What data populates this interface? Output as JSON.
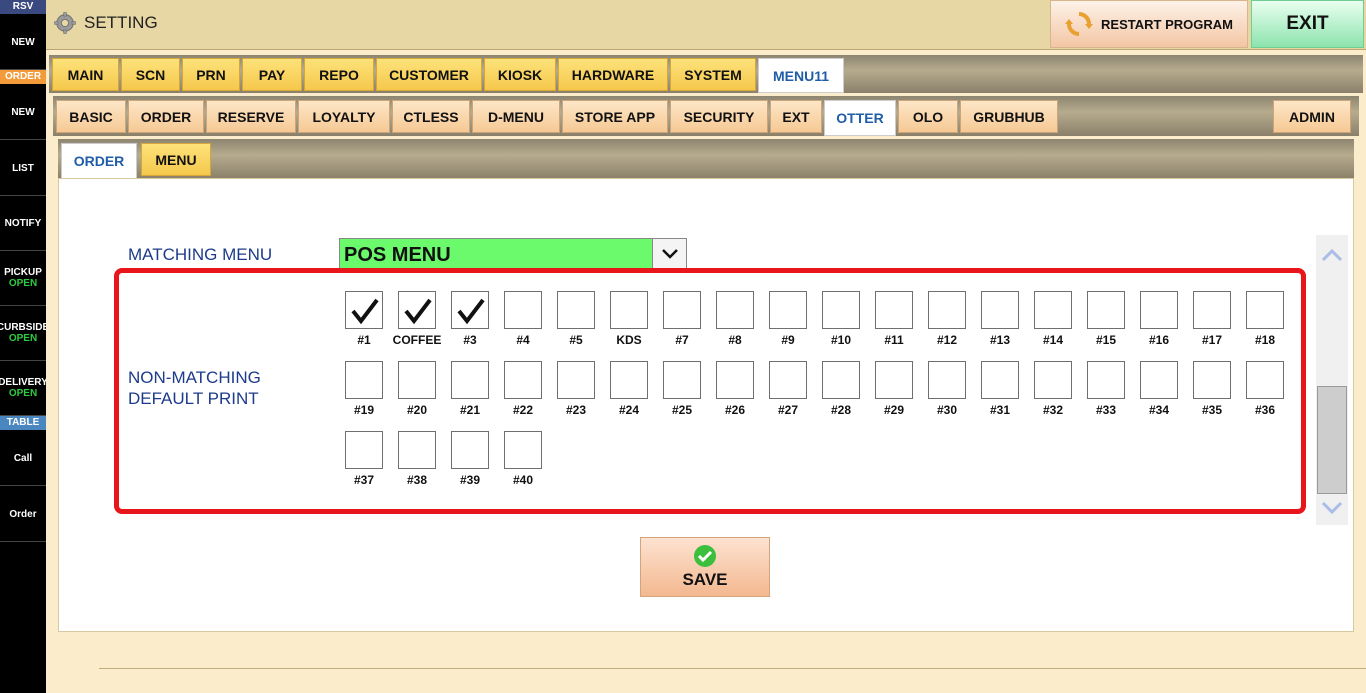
{
  "sidebar": {
    "headers": {
      "rsv": "RSV",
      "order": "ORDER",
      "table": "TABLE"
    },
    "header_colors": {
      "rsv": "#3a4a80",
      "order": "#f39a3a",
      "table": "#4a87c0"
    },
    "items": {
      "rsv_new": "NEW",
      "order_new": "NEW",
      "list": "LIST",
      "notify": "NOTIFY",
      "pickup": "PICKUP",
      "pickup_status": "OPEN",
      "curbside": "CURBSIDE",
      "curbside_status": "OPEN",
      "delivery": "DELIVERY",
      "delivery_status": "OPEN",
      "call": "Call",
      "order": "Order"
    }
  },
  "header": {
    "title": "SETTING",
    "restart_label": "RESTART PROGRAM",
    "exit_label": "EXIT"
  },
  "main_tabs": [
    "MAIN",
    "SCN",
    "PRN",
    "PAY",
    "REPO",
    "CUSTOMER",
    "KIOSK",
    "HARDWARE",
    "SYSTEM",
    "MENU11"
  ],
  "main_tab_active": "MENU11",
  "sub_tabs": [
    "BASIC",
    "ORDER",
    "RESERVE",
    "LOYALTY",
    "CTLESS",
    "D-MENU",
    "STORE APP",
    "SECURITY",
    "EXT",
    "OTTER",
    "OLO",
    "GRUBHUB"
  ],
  "sub_tab_active": "OTTER",
  "admin_tab": "ADMIN",
  "inner_tabs": [
    "ORDER",
    "MENU"
  ],
  "inner_tab_active": "ORDER",
  "form": {
    "matching_menu_label": "MATCHING MENU",
    "matching_menu_value": "POS MENU",
    "nonmatching_label_line1": "NON-MATCHING",
    "nonmatching_label_line2": "DEFAULT PRINT",
    "printers": [
      {
        "label": "#1",
        "checked": true
      },
      {
        "label": "COFFEE",
        "checked": true
      },
      {
        "label": "#3",
        "checked": true
      },
      {
        "label": "#4",
        "checked": false
      },
      {
        "label": "#5",
        "checked": false
      },
      {
        "label": "KDS",
        "checked": false
      },
      {
        "label": "#7",
        "checked": false
      },
      {
        "label": "#8",
        "checked": false
      },
      {
        "label": "#9",
        "checked": false
      },
      {
        "label": "#10",
        "checked": false
      },
      {
        "label": "#11",
        "checked": false
      },
      {
        "label": "#12",
        "checked": false
      },
      {
        "label": "#13",
        "checked": false
      },
      {
        "label": "#14",
        "checked": false
      },
      {
        "label": "#15",
        "checked": false
      },
      {
        "label": "#16",
        "checked": false
      },
      {
        "label": "#17",
        "checked": false
      },
      {
        "label": "#18",
        "checked": false
      },
      {
        "label": "#19",
        "checked": false
      },
      {
        "label": "#20",
        "checked": false
      },
      {
        "label": "#21",
        "checked": false
      },
      {
        "label": "#22",
        "checked": false
      },
      {
        "label": "#23",
        "checked": false
      },
      {
        "label": "#24",
        "checked": false
      },
      {
        "label": "#25",
        "checked": false
      },
      {
        "label": "#26",
        "checked": false
      },
      {
        "label": "#27",
        "checked": false
      },
      {
        "label": "#28",
        "checked": false
      },
      {
        "label": "#29",
        "checked": false
      },
      {
        "label": "#30",
        "checked": false
      },
      {
        "label": "#31",
        "checked": false
      },
      {
        "label": "#32",
        "checked": false
      },
      {
        "label": "#33",
        "checked": false
      },
      {
        "label": "#34",
        "checked": false
      },
      {
        "label": "#35",
        "checked": false
      },
      {
        "label": "#36",
        "checked": false
      },
      {
        "label": "#37",
        "checked": false
      },
      {
        "label": "#38",
        "checked": false
      },
      {
        "label": "#39",
        "checked": false
      },
      {
        "label": "#40",
        "checked": false
      }
    ],
    "save_label": "SAVE"
  },
  "colors": {
    "menu_select_bg": "#6bfa6b",
    "highlight_border": "#e8151a",
    "label_text": "#1d3b8a",
    "active_tab_text": "#1f5da8"
  }
}
